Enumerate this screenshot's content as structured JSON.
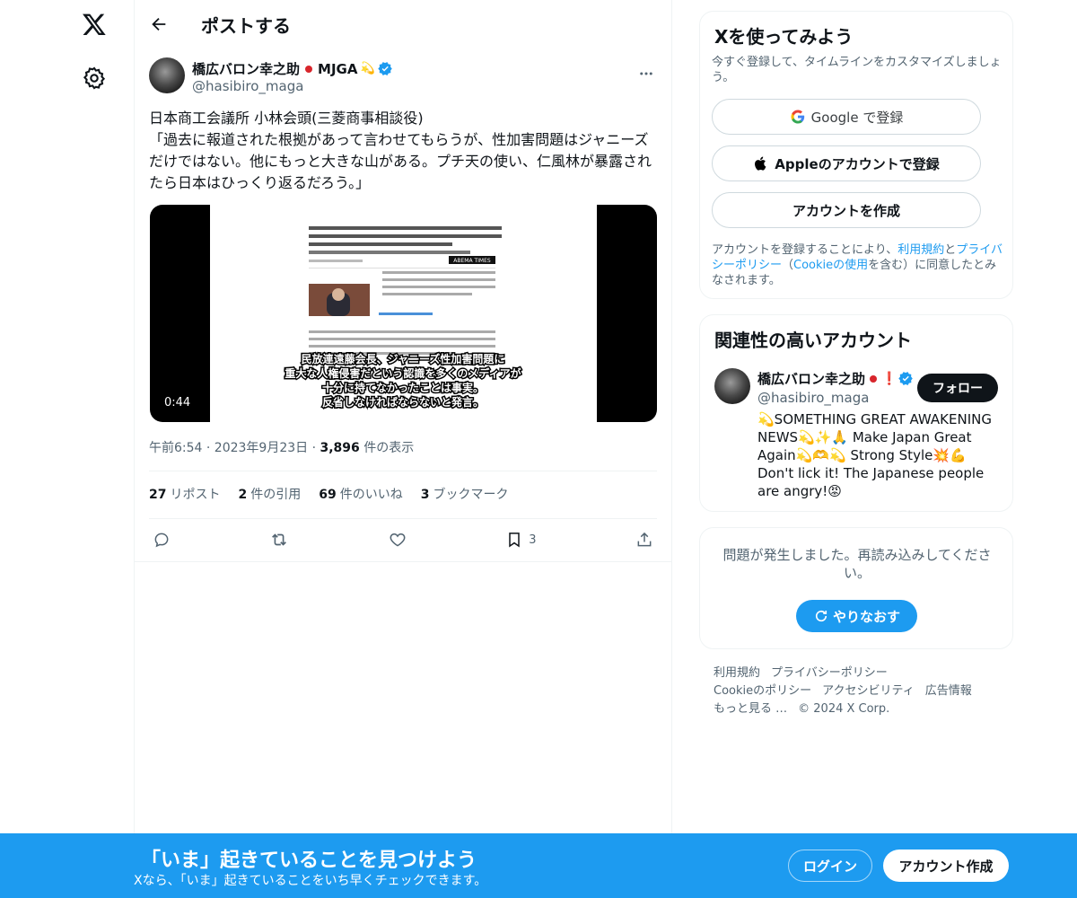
{
  "nav": {
    "logo": "x-logo-icon",
    "settings": "gear-icon"
  },
  "header": {
    "title": "ポストする"
  },
  "post": {
    "author_name": "橋広バロン幸之助",
    "author_tag": "MJGA",
    "author_handle": "@hasibiro_maga",
    "text": "日本商工会議所 小林会頭(三菱商事相談役)\n「過去に報道された根拠があって言わせてもらうが、性加害問題はジャニーズだけではない。他にもっと大きな山がある。プチ天の使い、仁風林が暴露されたら日本はひっくり返るだろう。」",
    "video_duration": "0:44",
    "video_caption_lines": [
      "民放連遠藤会長、ジャニーズ性加害問題に",
      "重大な人権侵害だという認識を多くのメディアが",
      "十分に持てなかったことは事実。",
      "反省しなければならないと発言。"
    ],
    "video_brand": "ABEMA TIMES",
    "time": "午前6:54 · 2023年9月23日",
    "views_count": "3,896",
    "views_label": "件の表示",
    "reposts_count": "27",
    "reposts_label": "リポスト",
    "quotes_count": "2",
    "quotes_label": "件の引用",
    "likes_count": "69",
    "likes_label": "件のいいね",
    "bookmarks_count": "3",
    "bookmarks_label": "ブックマーク",
    "bookmark_action_count": "3"
  },
  "signup_card": {
    "title": "Xを使ってみよう",
    "subtitle": "今すぐ登録して、タイムラインをカスタマイズしましょう。",
    "google_label": "Google で登録",
    "apple_label": "Appleのアカウントで登録",
    "create_label": "アカウントを作成",
    "legal_1": "アカウントを登録することにより、",
    "legal_terms": "利用規約",
    "legal_and": "と",
    "legal_privacy": "プライバシーポリシー",
    "legal_paren_open": "（",
    "legal_cookie": "Cookieの使用",
    "legal_2": "を含む）に同意したとみなされます。"
  },
  "related_card": {
    "title": "関連性の高いアカウント",
    "name": "橋広バロン幸之助",
    "handle": "@hasibiro_maga",
    "follow_label": "フォロー",
    "bio": "💫SOMETHING GREAT AWAKENING NEWS💫✨🙏 Make Japan Great Again💫🫶💫 Strong Style💥💪 Don't lick it! The Japanese people are angry!😡"
  },
  "error_card": {
    "message": "問題が発生しました。再読み込みしてください。",
    "retry_label": "やりなおす"
  },
  "footer": {
    "links": [
      "利用規約",
      "プライバシーポリシー",
      "Cookieのポリシー",
      "アクセシビリティ",
      "広告情報",
      "もっと見る …",
      "© 2024 X Corp."
    ]
  },
  "banner": {
    "title": "「いま」起きていることを見つけよう",
    "subtitle": "Xなら、「いま」起きていることをいち早くチェックできます。",
    "login_label": "ログイン",
    "signup_label": "アカウント作成"
  },
  "colors": {
    "accent": "#1d9bf0",
    "text": "#0f1419",
    "muted": "#536471"
  }
}
